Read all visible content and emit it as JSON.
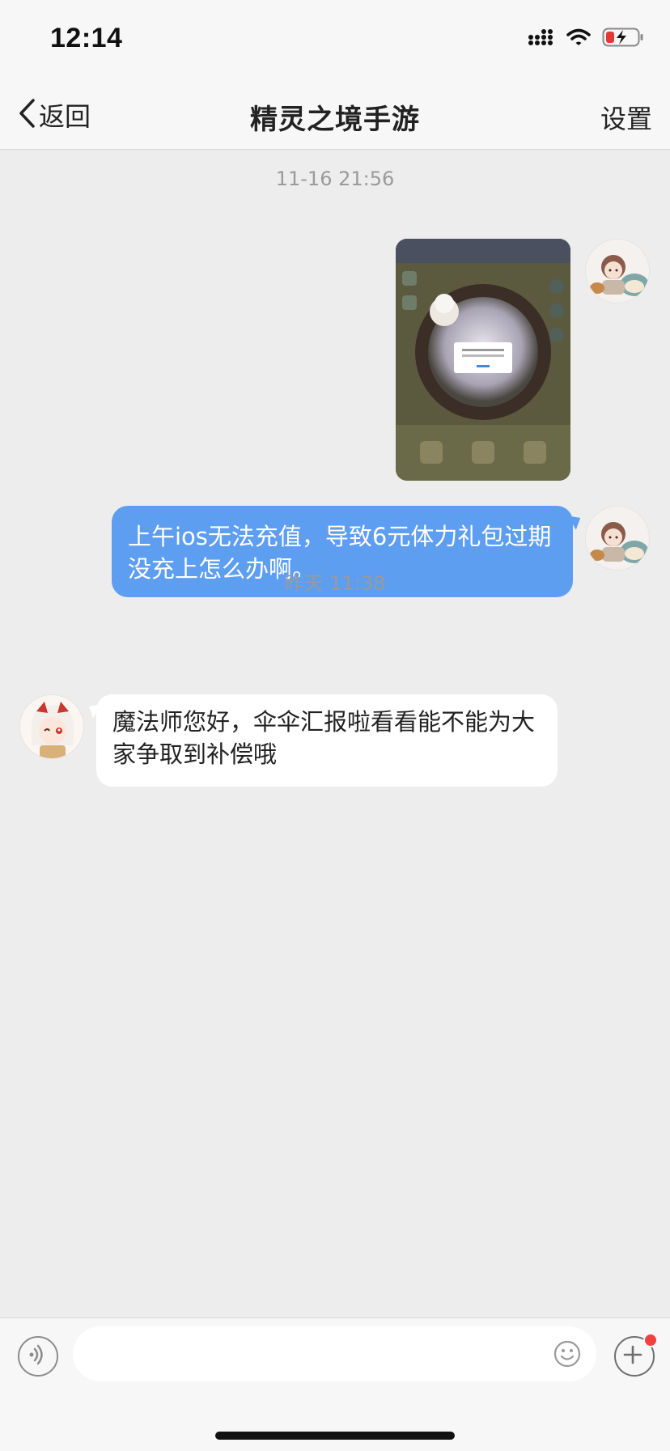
{
  "status_bar": {
    "time": "12:14",
    "icons": [
      "signal-icon",
      "wifi-icon",
      "battery-charging-icon"
    ],
    "battery_color": "#e53935"
  },
  "nav": {
    "back_label": "返回",
    "title": "精灵之境手游",
    "settings_label": "设置"
  },
  "messages": [
    {
      "timestamp": "11-16 21:56",
      "items": [
        {
          "type": "image",
          "sender": "me"
        },
        {
          "type": "text",
          "sender": "me",
          "text": "上午ios无法充值，导致6元体力礼包过期没充上怎么办啊。"
        }
      ]
    },
    {
      "timestamp": "昨天 11:38",
      "items": [
        {
          "type": "text",
          "sender": "support",
          "text": "魔法师您好，伞伞汇报啦看看能不能为大家争取到补偿哦"
        }
      ]
    }
  ],
  "input_bar": {
    "placeholder": "",
    "voice_icon": "voice-icon",
    "emoji_icon": "emoji-icon",
    "plus_icon": "plus-icon",
    "badge_color": "#f04040"
  },
  "colors": {
    "chat_background": "#ededed",
    "outgoing_bubble": "#5e9ef1",
    "incoming_bubble": "#ffffff"
  }
}
